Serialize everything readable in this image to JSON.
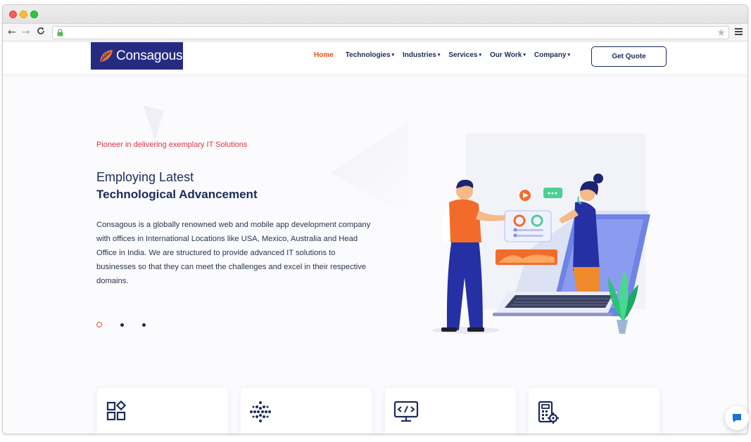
{
  "browser": {
    "controls": [
      "close",
      "minimize",
      "maximize"
    ],
    "nav": {
      "back": "←",
      "forward": "→",
      "reload": "C"
    },
    "url": "",
    "star": "★"
  },
  "header": {
    "logo_text": "Consagous",
    "nav_items": [
      {
        "label": "Home",
        "active": true,
        "caret": ""
      },
      {
        "label": "Technologies",
        "active": false,
        "caret": "▾"
      },
      {
        "label": "Industries",
        "active": false,
        "caret": "▾"
      },
      {
        "label": "Services",
        "active": false,
        "caret": "▾"
      },
      {
        "label": "Our Work",
        "active": false,
        "caret": "▾"
      },
      {
        "label": "Company",
        "active": false,
        "caret": "▾"
      }
    ],
    "cta": "Get Quote"
  },
  "hero": {
    "tagline": "Pioneer in delivering exemplary IT Solutions",
    "title_line1": "Employing Latest",
    "title_line2": "Technological Advancement",
    "description": "Consagous is a globally renowned web and mobile app development company with offices in International Locations like USA, Mexico, Australia and Head Office in India. We are structured to provide advanced IT solutions to businesses so that they can meet the challenges and excel in their respective domains.",
    "slides": 3,
    "active_slide": 1
  },
  "cards": [
    {
      "icon": "grid-shapes-icon"
    },
    {
      "icon": "dots-circle-icon"
    },
    {
      "icon": "monitor-code-icon"
    },
    {
      "icon": "calculator-gear-icon"
    }
  ],
  "colors": {
    "brand_navy": "#262b82",
    "text_navy": "#1c2b5a",
    "accent_orange": "#e8501d",
    "tagline_red": "#e5323f"
  }
}
